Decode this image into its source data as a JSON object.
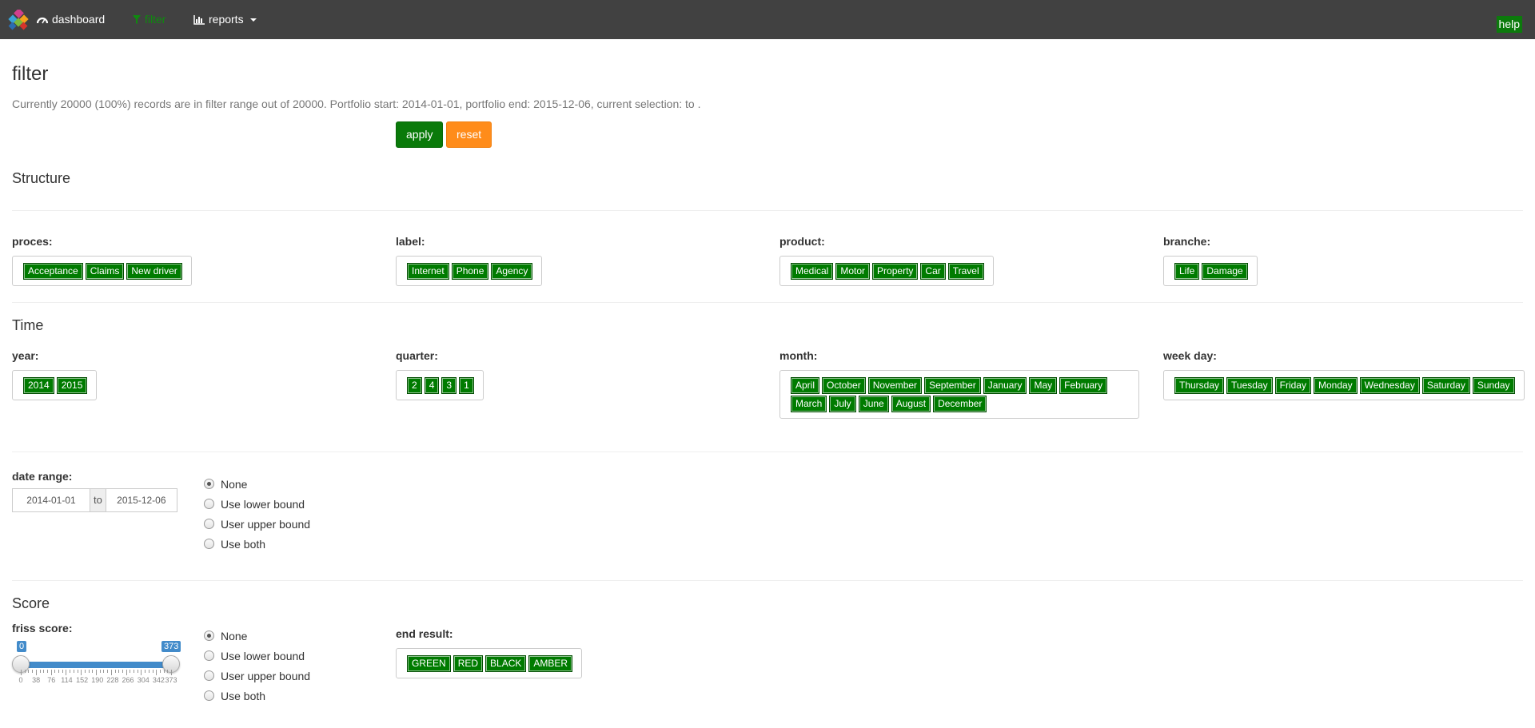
{
  "navbar": {
    "brand_label": "dashboard",
    "filter_label": "filter",
    "reports_label": "reports",
    "help_label": "help"
  },
  "page": {
    "title": "filter",
    "summary": "Currently 20000 (100%) records are in filter range out of 20000. Portfolio start: 2014-01-01, portfolio end: 2015-12-06, current selection: to ."
  },
  "actions": {
    "apply_label": "apply",
    "reset_label": "reset"
  },
  "sections": {
    "structure": "Structure",
    "time": "Time",
    "score": "Score"
  },
  "structure": {
    "proces": {
      "label": "proces:",
      "tags": [
        "Acceptance",
        "Claims",
        "New driver"
      ]
    },
    "label": {
      "label": "label:",
      "tags": [
        "Internet",
        "Phone",
        "Agency"
      ]
    },
    "product": {
      "label": "product:",
      "tags": [
        "Medical",
        "Motor",
        "Property",
        "Car",
        "Travel"
      ]
    },
    "branche": {
      "label": "branche:",
      "tags": [
        "Life",
        "Damage"
      ]
    }
  },
  "time": {
    "year": {
      "label": "year:",
      "tags": [
        "2014",
        "2015"
      ]
    },
    "quarter": {
      "label": "quarter:",
      "tags": [
        "2",
        "4",
        "3",
        "1"
      ]
    },
    "month": {
      "label": "month:",
      "tags": [
        "April",
        "October",
        "November",
        "September",
        "January",
        "May",
        "February",
        "March",
        "July",
        "June",
        "August",
        "December"
      ]
    },
    "weekday": {
      "label": "week day:",
      "tags": [
        "Thursday",
        "Tuesday",
        "Friday",
        "Monday",
        "Wednesday",
        "Saturday",
        "Sunday"
      ]
    }
  },
  "date_range": {
    "label": "date range:",
    "from": "2014-01-01",
    "sep": "to",
    "to": "2015-12-06",
    "options": [
      "None",
      "Use lower bound",
      "User upper bound",
      "Use both"
    ],
    "selected": 0
  },
  "score": {
    "label": "friss score:",
    "min": 0,
    "max": 373,
    "low_value": "0",
    "high_value": "373",
    "ticks": [
      "0",
      "38",
      "76",
      "114",
      "152",
      "190",
      "228",
      "266",
      "304",
      "342",
      "373"
    ],
    "options": [
      "None",
      "Use lower bound",
      "User upper bound",
      "Use both"
    ],
    "selected": 0
  },
  "end_result": {
    "label": "end result:",
    "tags": [
      "GREEN",
      "RED",
      "BLACK",
      "AMBER"
    ]
  },
  "colors": {
    "navbar": "#414141",
    "tag_green": "#007b00",
    "reset_orange": "#ff8c1a",
    "slider_blue": "#428bca"
  }
}
